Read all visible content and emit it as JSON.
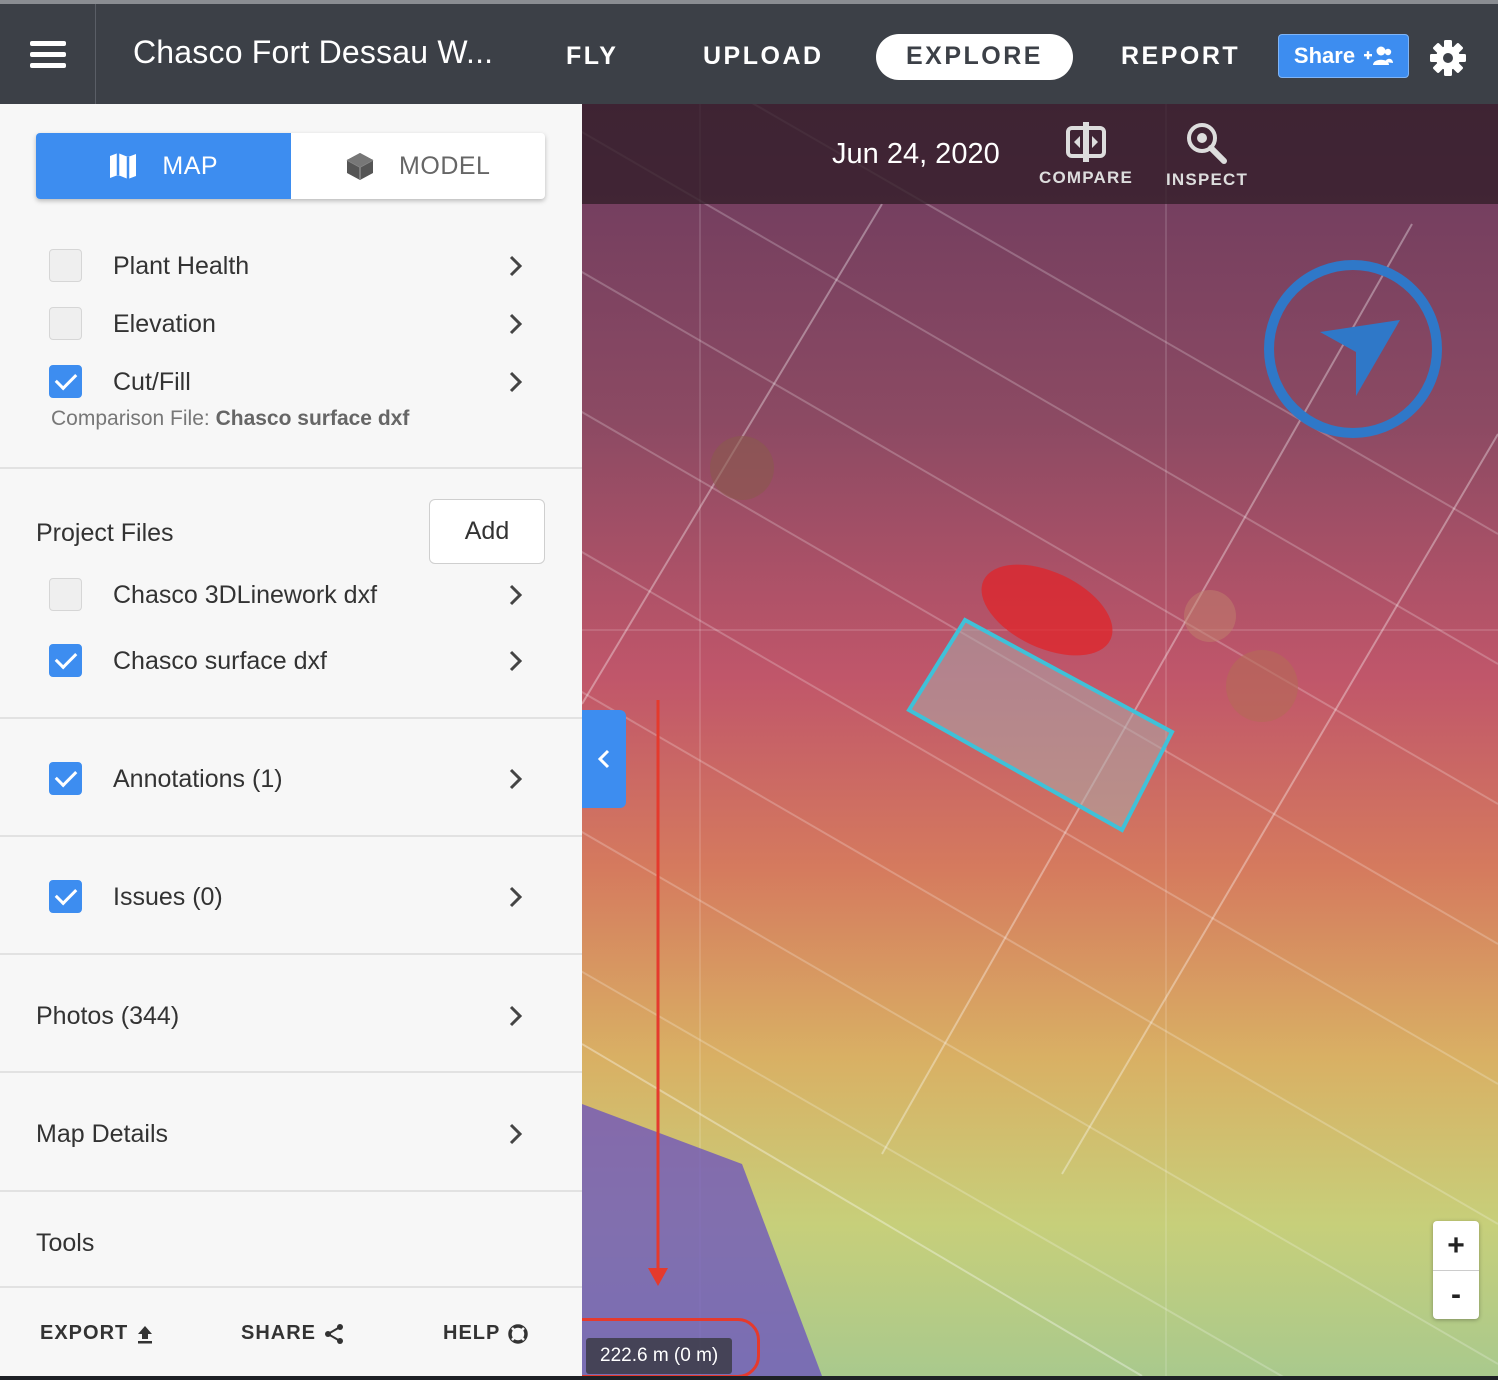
{
  "header": {
    "project_title": "Chasco Fort Dessau W...",
    "nav": [
      {
        "label": "FLY"
      },
      {
        "label": "UPLOAD"
      },
      {
        "label": "EXPLORE",
        "active": true
      },
      {
        "label": "REPORT"
      }
    ],
    "share_label": "Share",
    "accent_color": "#3d8df0"
  },
  "sidebar": {
    "view_toggle": {
      "map_label": "MAP",
      "model_label": "MODEL",
      "selected": "MAP"
    },
    "layers": [
      {
        "label": "Plant Health",
        "checked": false
      },
      {
        "label": "Elevation",
        "checked": false
      },
      {
        "label": "Cut/Fill",
        "checked": true
      }
    ],
    "comparison_prefix": "Comparison File:",
    "comparison_file": "Chasco surface dxf",
    "project_files": {
      "title": "Project Files",
      "add_label": "Add",
      "files": [
        {
          "label": "Chasco 3DLinework dxf",
          "checked": false
        },
        {
          "label": "Chasco surface dxf",
          "checked": true
        }
      ]
    },
    "annotations": {
      "label": "Annotations (1)",
      "checked": true
    },
    "issues": {
      "label": "Issues (0)",
      "checked": true
    },
    "photos_label": "Photos (344)",
    "map_details_label": "Map Details",
    "tools_label": "Tools",
    "footer": {
      "export_label": "EXPORT",
      "share_label": "SHARE",
      "help_label": "HELP"
    }
  },
  "map": {
    "date": "Jun 24, 2020",
    "compare_label": "COMPARE",
    "inspect_label": "INSPECT",
    "zoom_in": "+",
    "zoom_out": "-",
    "scale_label": "222.6 m (0 m)",
    "highlight_color": "#e53a2d",
    "annotation_color": "#3fc1d8"
  }
}
